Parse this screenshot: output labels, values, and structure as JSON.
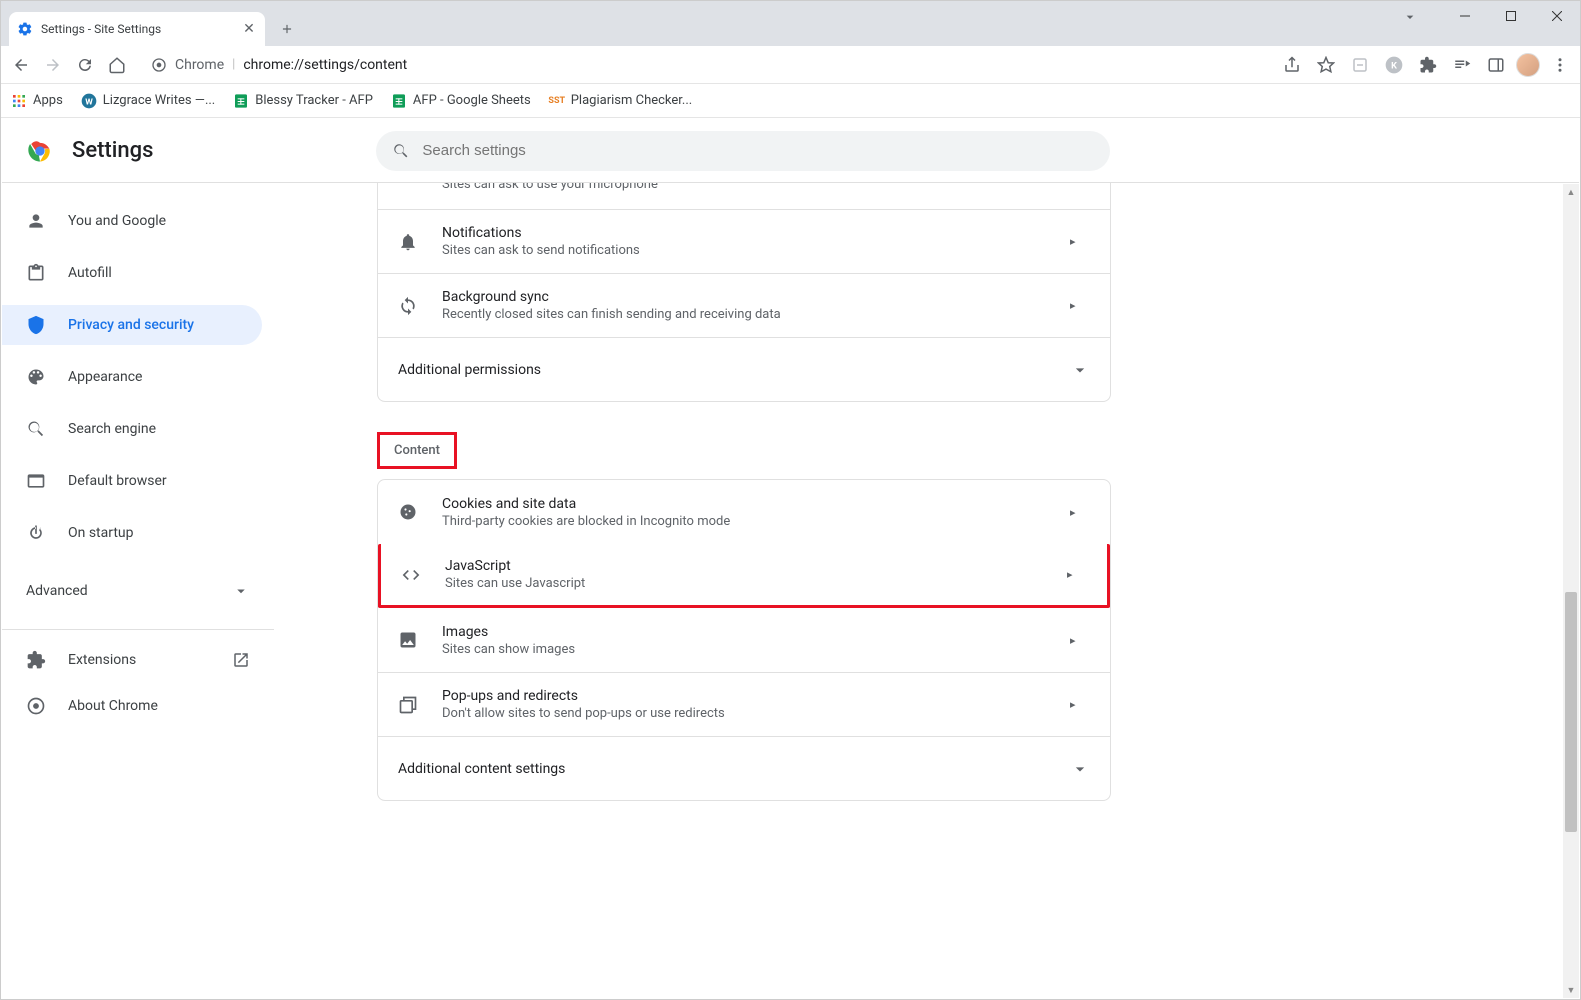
{
  "tab": {
    "title": "Settings - Site Settings"
  },
  "omnibox": {
    "prefix": "Chrome",
    "url": "chrome://settings/content"
  },
  "bookmarks": [
    {
      "label": "Apps",
      "icon": "apps"
    },
    {
      "label": "Lizgrace Writes —...",
      "icon": "wp"
    },
    {
      "label": "Blessy Tracker - AFP",
      "icon": "sheet"
    },
    {
      "label": "AFP - Google Sheets",
      "icon": "sheet"
    },
    {
      "label": "Plagiarism Checker...",
      "icon": "sst"
    }
  ],
  "header": {
    "title": "Settings",
    "search_placeholder": "Search settings"
  },
  "sidebar": {
    "items": [
      {
        "label": "You and Google"
      },
      {
        "label": "Autofill"
      },
      {
        "label": "Privacy and security"
      },
      {
        "label": "Appearance"
      },
      {
        "label": "Search engine"
      },
      {
        "label": "Default browser"
      },
      {
        "label": "On startup"
      }
    ],
    "advanced": "Advanced",
    "extensions": "Extensions",
    "about": "About Chrome"
  },
  "main": {
    "cutoff_desc": "Sites can ask to use your microphone",
    "permissions": [
      {
        "title": "Notifications",
        "desc": "Sites can ask to send notifications"
      },
      {
        "title": "Background sync",
        "desc": "Recently closed sites can finish sending and receiving data"
      }
    ],
    "additional_permissions": "Additional permissions",
    "content_heading": "Content",
    "content_items": [
      {
        "title": "Cookies and site data",
        "desc": "Third-party cookies are blocked in Incognito mode"
      },
      {
        "title": "JavaScript",
        "desc": "Sites can use Javascript"
      },
      {
        "title": "Images",
        "desc": "Sites can show images"
      },
      {
        "title": "Pop-ups and redirects",
        "desc": "Don't allow sites to send pop-ups or use redirects"
      }
    ],
    "additional_content": "Additional content settings"
  }
}
